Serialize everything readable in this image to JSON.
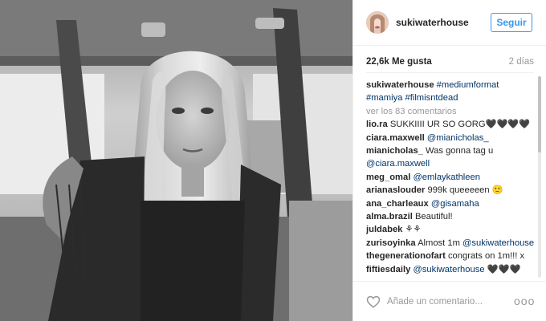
{
  "post": {
    "username": "sukiwaterhouse",
    "follow_label": "Seguir",
    "likes": "22,6k Me gusta",
    "time": "2 días",
    "caption": {
      "user": "sukiwaterhouse",
      "tags": [
        "#mediumformat",
        "#mamiya",
        "#filmisntdead"
      ]
    },
    "load_more": "ver los 83 comentarios",
    "comments": [
      {
        "user": "lio.ra",
        "text": "SUKKIIII UR SO GORG🖤🖤🖤🖤",
        "mention": ""
      },
      {
        "user": "ciara.maxwell",
        "text": "",
        "mention": "@mianicholas_"
      },
      {
        "user": "mianicholas_",
        "text": "Was gonna tag u",
        "mention": "@ciara.maxwell"
      },
      {
        "user": "meg_omal",
        "text": "",
        "mention": "@emlaykathleen"
      },
      {
        "user": "arianaslouder",
        "text": "999k queeeeen 🙂",
        "mention": ""
      },
      {
        "user": "ana_charleaux",
        "text": "",
        "mention": "@gisamaha"
      },
      {
        "user": "alma.brazil",
        "text": "Beautiful!",
        "mention": ""
      },
      {
        "user": "juldabek",
        "text": "⚘⚘",
        "mention": ""
      },
      {
        "user": "zurisoyinka",
        "text": "Almost 1m",
        "mention": "@sukiwaterhouse"
      },
      {
        "user": "thegenerationofart",
        "text": "congrats on 1m!!! x",
        "mention": ""
      },
      {
        "user": "fiftiesdaily",
        "text": "",
        "mention": "@sukiwaterhouse",
        "suffix": "🖤🖤🖤"
      }
    ],
    "comment_placeholder": "Añade un comentario...",
    "more_label": "ooo",
    "icons": {
      "like": "heart-icon",
      "more": "more-options-icon",
      "avatar": "avatar"
    },
    "colors": {
      "follow": "#3897f0",
      "link": "#003569",
      "muted": "#999999"
    }
  }
}
